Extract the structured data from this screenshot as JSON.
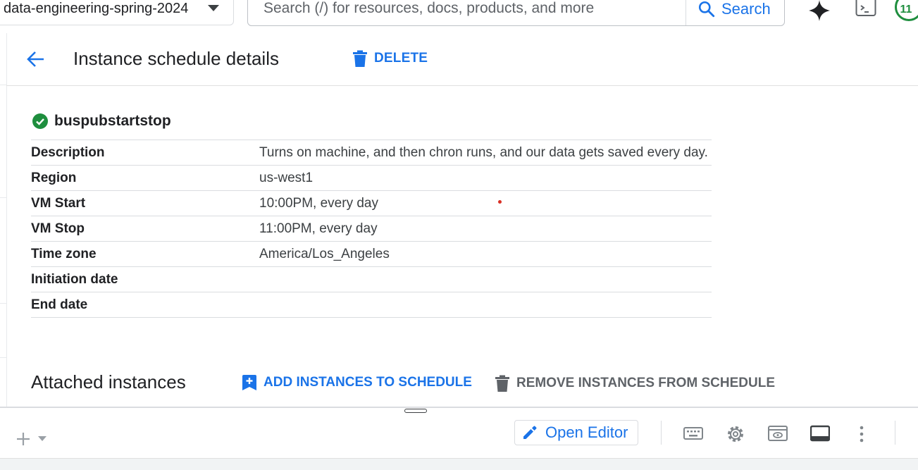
{
  "topbar": {
    "project": "data-engineering-spring-2024",
    "search_placeholder": "Search (/) for resources, docs, products, and more",
    "search_button": "Search",
    "badge": "11"
  },
  "header": {
    "title": "Instance schedule details",
    "delete_label": "DELETE"
  },
  "schedule": {
    "name": "buspubstartstop",
    "status": "ok",
    "rows": [
      {
        "key": "Description",
        "value": "Turns on machine, and then chron runs, and our data gets saved every day."
      },
      {
        "key": "Region",
        "value": "us-west1"
      },
      {
        "key": "VM Start",
        "value": "10:00PM, every day"
      },
      {
        "key": "VM Stop",
        "value": "11:00PM, every day"
      },
      {
        "key": "Time zone",
        "value": "America/Los_Angeles"
      },
      {
        "key": "Initiation date",
        "value": ""
      },
      {
        "key": "End date",
        "value": ""
      }
    ]
  },
  "attached": {
    "title": "Attached instances",
    "add_label": "ADD INSTANCES TO SCHEDULE",
    "remove_label": "REMOVE INSTANCES FROM SCHEDULE"
  },
  "bottom_panel": {
    "open_editor": "Open Editor",
    "icons": [
      "add-icon",
      "chevron-down-icon",
      "pencil-icon",
      "keyboard-icon",
      "settings-icon",
      "preview-icon",
      "panel-icon",
      "more-vert-icon"
    ]
  },
  "colors": {
    "accent": "#1a73e8",
    "success": "#1e8e3e",
    "muted": "#5f6368"
  }
}
